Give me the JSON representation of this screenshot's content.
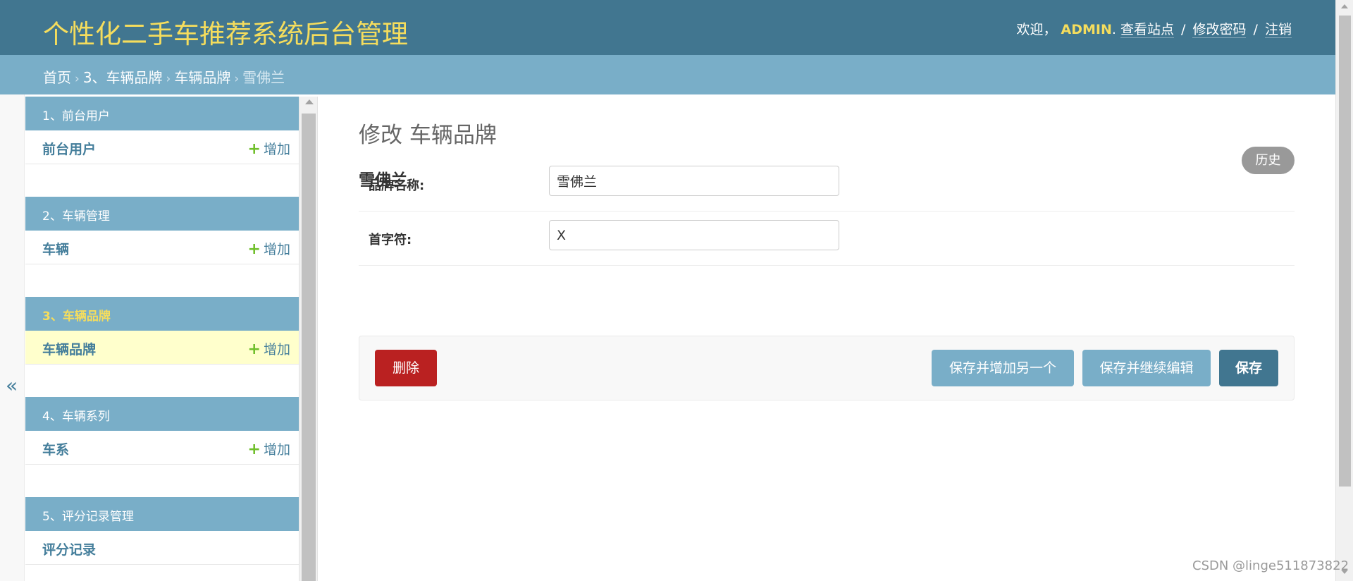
{
  "header": {
    "site_title": "个性化二手车推荐系统后台管理",
    "welcome": "欢迎，",
    "username": "ADMIN",
    "username_suffix": ".",
    "links": [
      "查看站点",
      "修改密码",
      "注销"
    ],
    "separator": "/"
  },
  "breadcrumbs": {
    "items": [
      "首页",
      "3、车辆品牌",
      "车辆品牌"
    ],
    "current": "雪佛兰",
    "arrow": "›"
  },
  "nav_toggle": {
    "glyph": "«",
    "icon": "chevron-double-left-icon"
  },
  "sidebar": {
    "modules": [
      {
        "caption": "1、前台用户",
        "active": false,
        "row": {
          "label": "前台用户",
          "add": "增加",
          "has_add": true,
          "active": false
        }
      },
      {
        "caption": "2、车辆管理",
        "active": false,
        "row": {
          "label": "车辆",
          "add": "增加",
          "has_add": true,
          "active": false
        }
      },
      {
        "caption": "3、车辆品牌",
        "active": true,
        "row": {
          "label": "车辆品牌",
          "add": "增加",
          "has_add": true,
          "active": true
        }
      },
      {
        "caption": "4、车辆系列",
        "active": false,
        "row": {
          "label": "车系",
          "add": "增加",
          "has_add": true,
          "active": false
        }
      },
      {
        "caption": "5、评分记录管理",
        "active": false,
        "row": {
          "label": "评分记录",
          "add": "",
          "has_add": false,
          "active": false
        }
      }
    ],
    "add_icon": "plus-icon",
    "add_glyph": "+"
  },
  "content": {
    "page_title": "修改 车辆品牌",
    "history_label": "历史",
    "object_title": "雪佛兰",
    "fields": [
      {
        "label": "品牌名称:",
        "value": "雪佛兰"
      },
      {
        "label": "首字符:",
        "value": "X"
      }
    ],
    "buttons": {
      "delete": "删除",
      "save_add_another": "保存并增加另一个",
      "save_continue": "保存并继续编辑",
      "save": "保存"
    }
  },
  "colors": {
    "header_bg": "#417690",
    "breadcrumb_bg": "#79aec8",
    "title_yellow": "#f5dd5d",
    "link_blue": "#447e9b",
    "active_row_bg": "#ffffcc",
    "add_plus_green": "#70bf2b",
    "delete_red": "#ba2121",
    "history_gray": "#999999"
  },
  "watermark": "CSDN @linge511873822"
}
